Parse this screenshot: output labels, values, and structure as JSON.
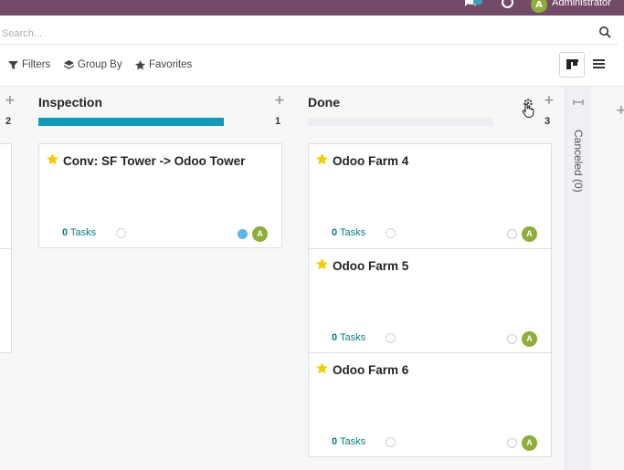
{
  "navbar": {
    "user_name": "Administrator",
    "avatar_letter": "A"
  },
  "search": {
    "placeholder": "Search..."
  },
  "filters": {
    "filters_label": "Filters",
    "groupby_label": "Group By",
    "favorites_label": "Favorites"
  },
  "columns": [
    {
      "title": "",
      "count": "2"
    },
    {
      "title": "Inspection",
      "count": "1",
      "progress": 1.0,
      "cards": [
        {
          "title": "Conv: SF Tower -> Odoo Tower",
          "tasks_count": "0",
          "tasks_label": "Tasks",
          "status": "blue",
          "avatar": "A"
        }
      ]
    },
    {
      "title": "Done",
      "count": "3",
      "progress": 0,
      "cards": [
        {
          "title": "Odoo Farm 4",
          "tasks_count": "0",
          "tasks_label": "Tasks",
          "status": "grey",
          "avatar": "A"
        },
        {
          "title": "Odoo Farm 5",
          "tasks_count": "0",
          "tasks_label": "Tasks",
          "status": "grey",
          "avatar": "A"
        },
        {
          "title": "Odoo Farm 6",
          "tasks_count": "0",
          "tasks_label": "Tasks",
          "status": "grey",
          "avatar": "A"
        }
      ]
    }
  ],
  "folded_column": {
    "label": "Canceled (0)"
  },
  "colors": {
    "navbar": "#714b67",
    "progress": "#119ab8",
    "avatar": "#8fad3a",
    "tasks_link": "#017e84",
    "star": "#f3cc00"
  }
}
